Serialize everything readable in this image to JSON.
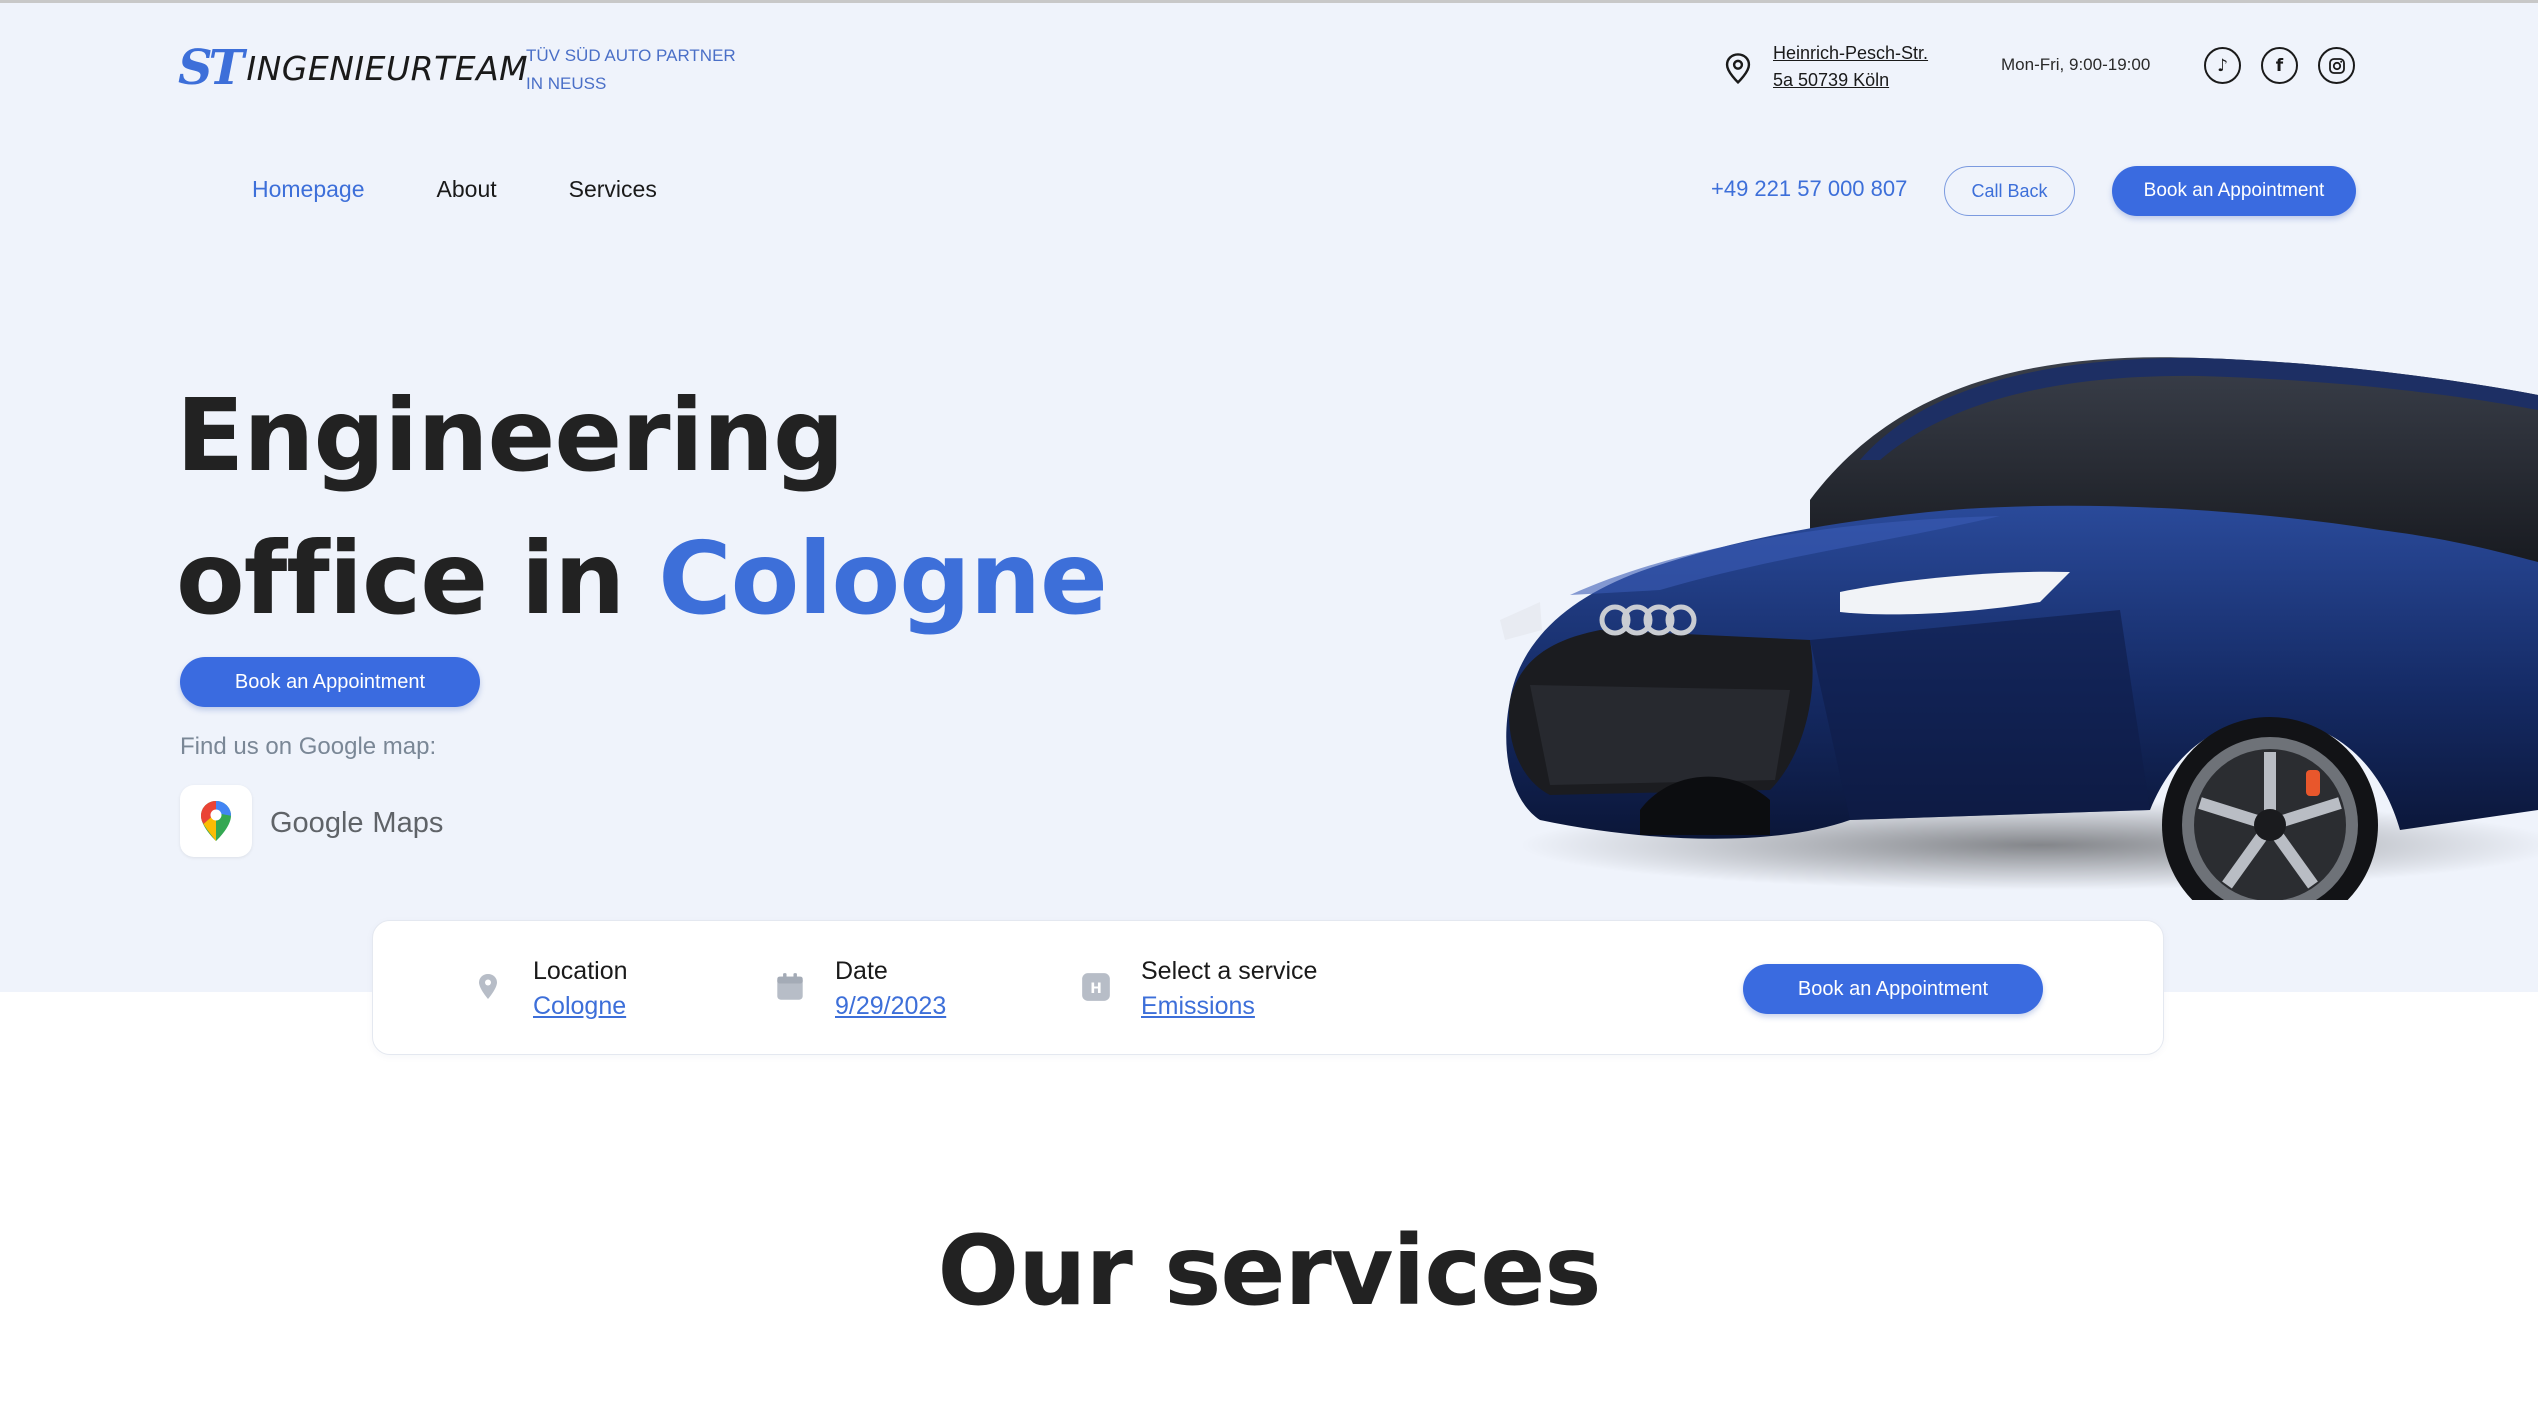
{
  "header": {
    "logo_mark": "ST",
    "logo_text": "INGENIEURTEAM",
    "partner_line1": "TÜV SÜD AUTO PARTNER",
    "partner_line2": "IN NEUSS",
    "address_line1": "Heinrich-Pesch-Str.",
    "address_line2": "5a 50739 Köln",
    "hours": "Mon-Fri, 9:00-19:00",
    "socials": [
      {
        "icon": "tiktok-icon",
        "glyph": "♪"
      },
      {
        "icon": "facebook-icon",
        "glyph": "f"
      },
      {
        "icon": "instagram-icon",
        "glyph": "◎"
      }
    ]
  },
  "nav": {
    "items": [
      {
        "label": "Homepage",
        "active": true
      },
      {
        "label": "About",
        "active": false
      },
      {
        "label": "Services",
        "active": false
      }
    ],
    "phone": "+49 221 57 000 807",
    "call_back_label": "Call Back",
    "book_label": "Book an Appointment"
  },
  "hero": {
    "title_line1": "Engineering",
    "title_line2_prefix": "office in ",
    "title_line2_accent": "Cologne",
    "book_label": "Book an Appointment",
    "find_us": "Find us on Google map:",
    "gmaps_brand": "Google",
    "gmaps_product": "Maps"
  },
  "booking": {
    "location_label": "Location",
    "location_value": "Cologne",
    "date_label": "Date",
    "date_value": "9/29/2023",
    "service_label": "Select a service",
    "service_value": "Emissions",
    "book_label": "Book an Appointment"
  },
  "services": {
    "title": "Our services"
  },
  "colors": {
    "accent": "#3d6fd9",
    "hero_bg": "#eff3fb",
    "text": "#222222"
  }
}
